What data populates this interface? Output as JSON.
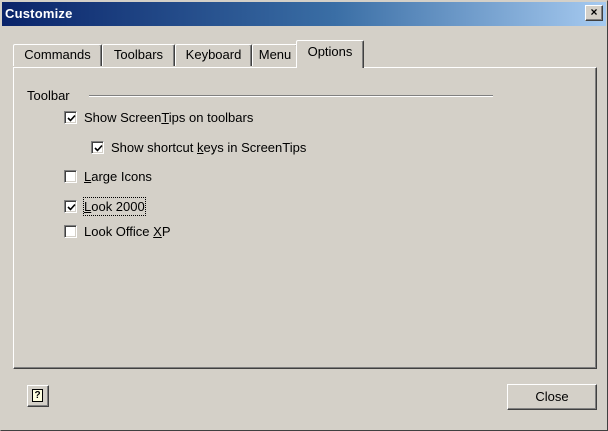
{
  "window": {
    "title": "Customize",
    "close_glyph": "×"
  },
  "tabs": [
    {
      "label": "Commands"
    },
    {
      "label": "Toolbars"
    },
    {
      "label": "Keyboard"
    },
    {
      "label": "Menu"
    },
    {
      "label": "Options",
      "active": true
    }
  ],
  "toolbar_group": {
    "label": "Toolbar",
    "options": [
      {
        "label_pre": "Show Screen",
        "label_u": "T",
        "label_post": "ips on toolbars",
        "checked": true
      },
      {
        "label_pre": "Show shortcut ",
        "label_u": "k",
        "label_post": "eys in ScreenTips",
        "checked": true
      },
      {
        "label_pre": "",
        "label_u": "L",
        "label_post": "arge Icons",
        "checked": false
      },
      {
        "label_pre": "",
        "label_u": "L",
        "label_post": "ook 2000",
        "checked": true
      },
      {
        "label_pre": "Look Office ",
        "label_u": "X",
        "label_post": "P",
        "checked": false
      }
    ]
  },
  "buttons": {
    "help_glyph": "?",
    "help_icon": "help-icon",
    "close_label": "Close"
  },
  "colors": {
    "face": "#d4d0c8",
    "title_start": "#0a246a",
    "title_end": "#a6caf0"
  }
}
